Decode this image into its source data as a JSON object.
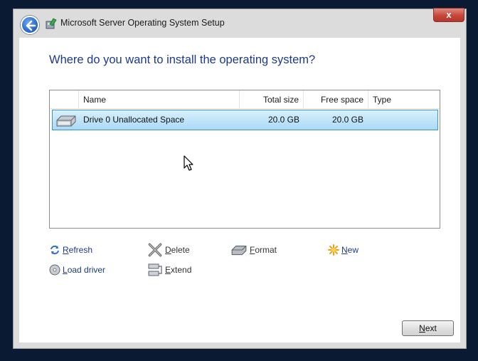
{
  "window": {
    "title": "Microsoft Server Operating System Setup",
    "close_label": "x"
  },
  "page": {
    "heading": "Where do you want to install the operating system?"
  },
  "table": {
    "columns": {
      "name": "Name",
      "total": "Total size",
      "free": "Free space",
      "type": "Type"
    },
    "rows": [
      {
        "name": "Drive 0 Unallocated Space",
        "total": "20.0 GB",
        "free": "20.0 GB",
        "type": "",
        "icon": "disk-drive-icon",
        "selected": true
      }
    ]
  },
  "actions": {
    "refresh": {
      "prefix": "",
      "key": "R",
      "rest": "efresh",
      "icon": "refresh-icon"
    },
    "delete": {
      "prefix": "",
      "key": "D",
      "rest": "elete",
      "icon": "delete-x-icon"
    },
    "format": {
      "prefix": "",
      "key": "F",
      "rest": "ormat",
      "icon": "format-disk-icon"
    },
    "new": {
      "prefix": "",
      "key": "N",
      "rest": "ew",
      "icon": "new-star-icon"
    },
    "load_driver": {
      "prefix": "",
      "key": "L",
      "rest": "oad driver",
      "icon": "load-driver-icon"
    },
    "extend": {
      "prefix": "",
      "key": "E",
      "rest": "xtend",
      "icon": "extend-icon"
    }
  },
  "footer": {
    "next": {
      "key": "N",
      "rest": "ext"
    }
  },
  "colors": {
    "heading": "#1d3a8a",
    "selection": "#a9daf6",
    "link": "#1d3a8a"
  }
}
